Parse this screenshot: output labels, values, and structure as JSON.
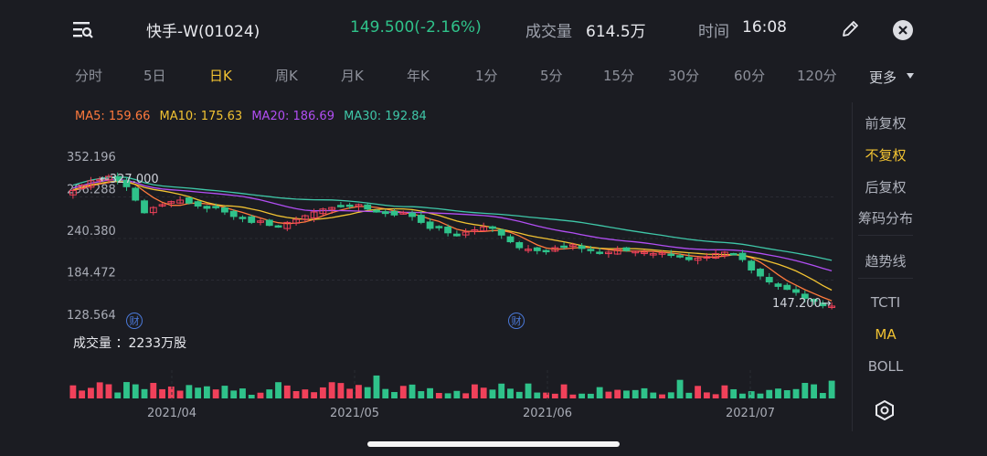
{
  "header": {
    "title": "快手-W(01024)",
    "price": "149.500(-2.16%)",
    "volume_label": "成交量",
    "volume_value": "614.5万",
    "time_label": "时间",
    "time_value": "16:08",
    "price_color": "#2fc28a"
  },
  "tabs": [
    {
      "label": "分时"
    },
    {
      "label": "5日"
    },
    {
      "label": "日K",
      "active": true
    },
    {
      "label": "周K"
    },
    {
      "label": "月K"
    },
    {
      "label": "年K"
    },
    {
      "label": "1分"
    },
    {
      "label": "5分"
    },
    {
      "label": "15分"
    },
    {
      "label": "30分"
    },
    {
      "label": "60分"
    },
    {
      "label": "120分"
    }
  ],
  "more_label": "更多",
  "ma_legend": [
    {
      "text": "MA5: 159.66",
      "color": "#ff7a3d"
    },
    {
      "text": "MA10: 175.63",
      "color": "#f1c232"
    },
    {
      "text": "MA20: 186.69",
      "color": "#b14ef3"
    },
    {
      "text": "MA30: 192.84",
      "color": "#3fc7a8"
    }
  ],
  "right_panel": {
    "adjust": [
      {
        "label": "前复权"
      },
      {
        "label": "不复权",
        "selected": true
      },
      {
        "label": "后复权"
      },
      {
        "label": "筹码分布"
      }
    ],
    "trend_line": "趋势线",
    "indicators": [
      {
        "label": "TCTI"
      },
      {
        "label": "MA",
        "selected": true
      },
      {
        "label": "BOLL"
      }
    ]
  },
  "chart_data": {
    "type": "candlestick",
    "y_ticks": [
      "352.196",
      "296.288",
      "240.380",
      "184.472",
      "128.564"
    ],
    "ylim": [
      128.564,
      352.196
    ],
    "x_ticks": [
      "2021/04",
      "2021/05",
      "2021/06",
      "2021/07"
    ],
    "high_annotation": "←327.000",
    "low_annotation": "147.200→",
    "high_value": 327.0,
    "low_value": 147.2,
    "volume_label": "成交量 ：2233万股",
    "event_marker": "财",
    "colors": {
      "up": "#f0415a",
      "down": "#2fc28a"
    },
    "closes": [
      305,
      312,
      318,
      320,
      324,
      318,
      310,
      292,
      275,
      282,
      286,
      290,
      292,
      288,
      284,
      281,
      282,
      276,
      270,
      268,
      262,
      264,
      258,
      256,
      262,
      266,
      271,
      276,
      280,
      282,
      284,
      285,
      286,
      280,
      276,
      274,
      272,
      275,
      270,
      262,
      254,
      256,
      248,
      244,
      249,
      252,
      256,
      254,
      245,
      236,
      228,
      226,
      224,
      224,
      228,
      230,
      232,
      227,
      224,
      222,
      222,
      226,
      224,
      223,
      222,
      220,
      221,
      218,
      216,
      212,
      214,
      216,
      220,
      222,
      220,
      212,
      198,
      190,
      182,
      176,
      172,
      168,
      160,
      156,
      150,
      149.5
    ]
  }
}
